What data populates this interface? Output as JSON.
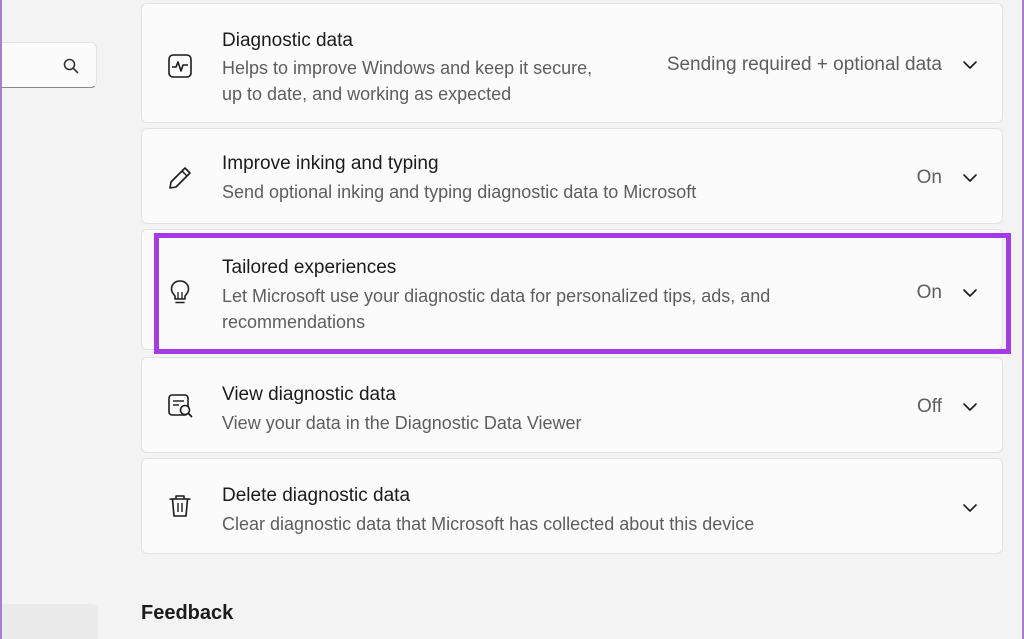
{
  "search": {
    "icon": "search-icon"
  },
  "cards": [
    {
      "icon": "diagnostic-pulse-icon",
      "title": "Diagnostic data",
      "description": "Helps to improve Windows and keep it secure, up to date, and working as expected",
      "value": "Sending required + optional data"
    },
    {
      "icon": "pen-icon",
      "title": "Improve inking and typing",
      "description": "Send optional inking and typing diagnostic data to Microsoft",
      "value": "On"
    },
    {
      "icon": "lightbulb-icon",
      "title": "Tailored experiences",
      "description": "Let Microsoft use your diagnostic data for personalized tips, ads, and recommendations",
      "value": "On"
    },
    {
      "icon": "data-viewer-icon",
      "title": "View diagnostic data",
      "description": "View your data in the Diagnostic Data Viewer",
      "value": "Off"
    },
    {
      "icon": "trash-icon",
      "title": "Delete diagnostic data",
      "description": "Clear diagnostic data that Microsoft has collected about this device",
      "value": ""
    }
  ],
  "feedback": {
    "heading": "Feedback"
  },
  "colors": {
    "highlight": "#a63ae6",
    "frame": "#a77fd2"
  }
}
